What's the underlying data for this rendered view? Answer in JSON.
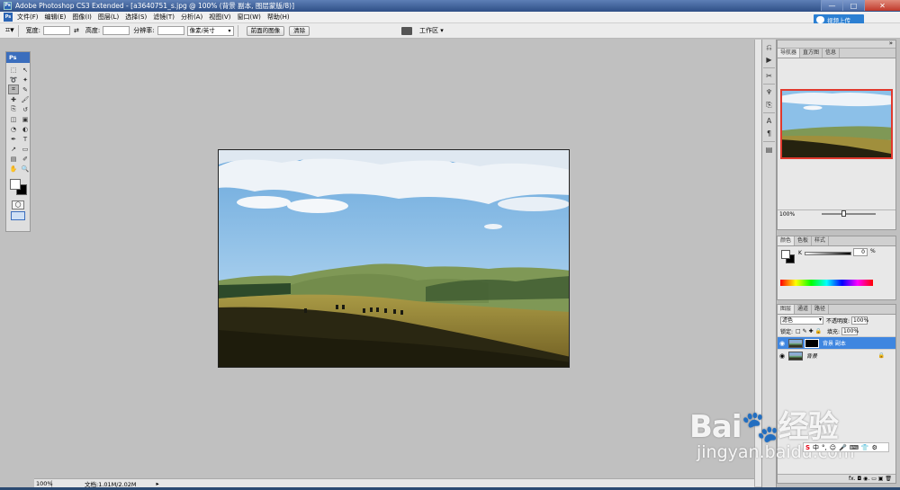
{
  "window": {
    "title": "Adobe Photoshop CS3 Extended - [a3640751_s.jpg @ 100% (背景 副本, 图层蒙版/8)]",
    "controls": [
      "—",
      "□",
      "✕"
    ]
  },
  "menu": {
    "items": [
      "文件(F)",
      "编辑(E)",
      "图像(I)",
      "图层(L)",
      "选择(S)",
      "滤镜(T)",
      "分析(A)",
      "视图(V)",
      "窗口(W)",
      "帮助(H)"
    ],
    "cloud_button": "视频上传"
  },
  "options": {
    "width_label": "宽度:",
    "height_label": "高度:",
    "resolution_label": "分辨率:",
    "unit_select": "像素/英寸",
    "front_image_button": "前面的图像",
    "clear_button": "清除",
    "workspace_label": "工作区 ▾"
  },
  "toolbox": {
    "header": "Ps",
    "tools": [
      "marquee-tool-icon",
      "move-tool-icon",
      "lasso-tool-icon",
      "magic-wand-tool-icon",
      "crop-tool-icon",
      "slice-tool-icon",
      "healing-brush-tool-icon",
      "brush-tool-icon",
      "clone-stamp-tool-icon",
      "history-brush-tool-icon",
      "eraser-tool-icon",
      "gradient-tool-icon",
      "blur-tool-icon",
      "dodge-tool-icon",
      "pen-tool-icon",
      "type-tool-icon",
      "path-select-tool-icon",
      "shape-tool-icon",
      "notes-tool-icon",
      "eyedropper-tool-icon",
      "hand-tool-icon",
      "zoom-tool-icon"
    ],
    "glyphs": [
      "⬚",
      "↖",
      "➰",
      "✦",
      "⌗",
      "✎",
      "✚",
      "🖌",
      "⎘",
      "↺",
      "◫",
      "▣",
      "◔",
      "◐",
      "✒",
      "T",
      "↗",
      "▭",
      "▤",
      "✐",
      "✋",
      "🔍"
    ]
  },
  "status": {
    "zoom": "100%",
    "doc_size": "文档:1.01M/2.02M",
    "arrow": "▸"
  },
  "navigator": {
    "tabs": [
      "导航器",
      "直方图",
      "信息"
    ],
    "zoom": "100%"
  },
  "color_panel": {
    "tabs": [
      "颜色",
      "色板",
      "样式"
    ],
    "channel_label": "K",
    "value": "0",
    "unit": "%"
  },
  "layers_panel": {
    "tabs": [
      "图层",
      "通道",
      "路径"
    ],
    "blend_mode": "滤色",
    "opacity_label": "不透明度:",
    "opacity": "100%",
    "lock_label": "锁定:",
    "fill_label": "填充:",
    "fill": "100%",
    "layers": [
      {
        "name": "背景 副本",
        "active": true
      },
      {
        "name": "背景",
        "active": false
      }
    ],
    "bottom_icons": "fx. ◘ ◉. ▭ ▣ 🗑"
  },
  "watermark": {
    "brand": "Bai🐾经验",
    "url": "jingyan.baidu.com"
  },
  "ime": {
    "items": [
      "S",
      "中",
      "°,",
      "☺",
      "🎤",
      "⌨",
      "👕",
      "⚙"
    ]
  },
  "colors": {
    "title_bar": "#2e4f86",
    "panel_bg": "#e8e8e8",
    "active_layer": "#3f86e0",
    "workspace_bg": "#c0c0c0"
  }
}
